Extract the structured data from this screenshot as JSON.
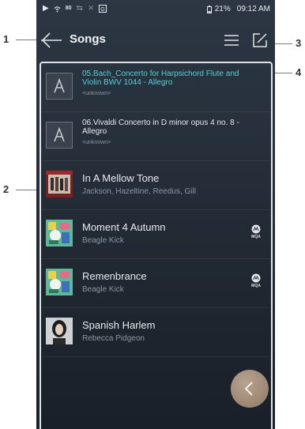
{
  "callouts": [
    "1",
    "2",
    "3",
    "4"
  ],
  "status": {
    "kbps": "80",
    "battery": "21%",
    "time": "09:12 AM",
    "icons": [
      "play-icon",
      "wifi-icon",
      "repeat-icon",
      "shuffle-icon",
      "gapless-icon",
      "battery-icon"
    ]
  },
  "header": {
    "title": "Songs"
  },
  "songs": [
    {
      "title": "05.Bach_Concerto for Harpsichord Flute and Violin BWV 1044 - Allegro",
      "subtitle": "<unknown>",
      "artwork": "astell-logo",
      "title_color": "#4fd0d8",
      "mqa": false
    },
    {
      "title": "06.Vivaldi Concerto in D minor opus 4 no. 8 - Allegro",
      "subtitle": "<unknown>",
      "artwork": "astell-logo",
      "title_color": "#e8ebee",
      "mqa": false
    },
    {
      "title": "In A Mellow Tone",
      "subtitle": "Jackson, Hazeltine, Reedus, Gill",
      "artwork": "album-red",
      "mqa": false
    },
    {
      "title": "Moment 4 Autumn",
      "subtitle": "Beagle Kick",
      "artwork": "album-green",
      "mqa": true
    },
    {
      "title": "Remenbrance",
      "subtitle": "Beagle Kick",
      "artwork": "album-green",
      "mqa": true
    },
    {
      "title": "Spanish Harlem",
      "subtitle": "Rebecca Pidgeon",
      "artwork": "album-portrait",
      "mqa": false
    }
  ],
  "mqa_label": "MQA",
  "colors": {
    "accent": "#4fd0d8",
    "fab": "#a08a75",
    "background": "#262f3a"
  }
}
